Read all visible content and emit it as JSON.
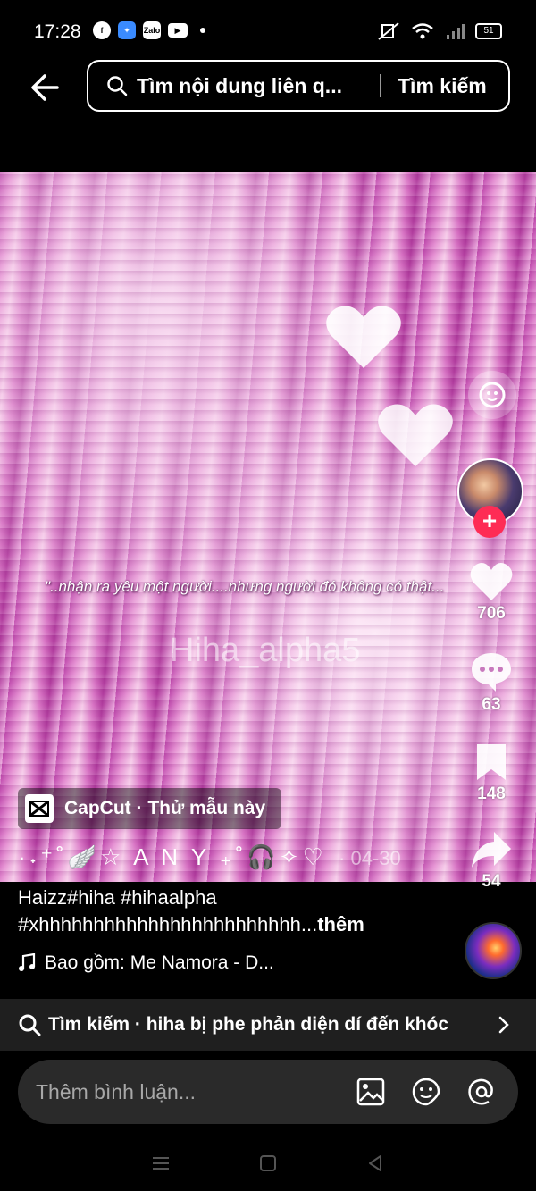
{
  "status_bar": {
    "time": "17:28",
    "app_icons": [
      "facebook-icon",
      "messenger-icon",
      "zalo-icon",
      "youtube-icon"
    ],
    "zalo_label": "Zalo",
    "battery": "51"
  },
  "header": {
    "search_query": "Tìm nội dung liên q...",
    "search_button": "Tìm kiếm"
  },
  "video": {
    "caption_overlay": "\"..nhận ra yêu một người....nhưng người đó không có thật...",
    "watermark": "Hiha_alpha5",
    "capcut_label": "CapCut · Thử mẫu này",
    "author": "·˖⁺˚🪽☆ A N Y ₊˚🎧✧♡",
    "date": "· 04-30"
  },
  "actions": {
    "likes": "706",
    "comments": "63",
    "saves": "148",
    "shares": "54"
  },
  "description": {
    "line1": "Haizz#hiha #hihaalpha",
    "line2": "#xhhhhhhhhhhhhhhhhhhhhhhhh...",
    "more": "thêm",
    "music": "Bao gồm: Me Namora - D..."
  },
  "related_search": {
    "label": "Tìm kiếm · hiha bị phe phản diện dí đến khóc"
  },
  "comment_bar": {
    "placeholder": "Thêm bình luận..."
  },
  "colors": {
    "accent": "#fe2c55",
    "background": "#000000"
  }
}
